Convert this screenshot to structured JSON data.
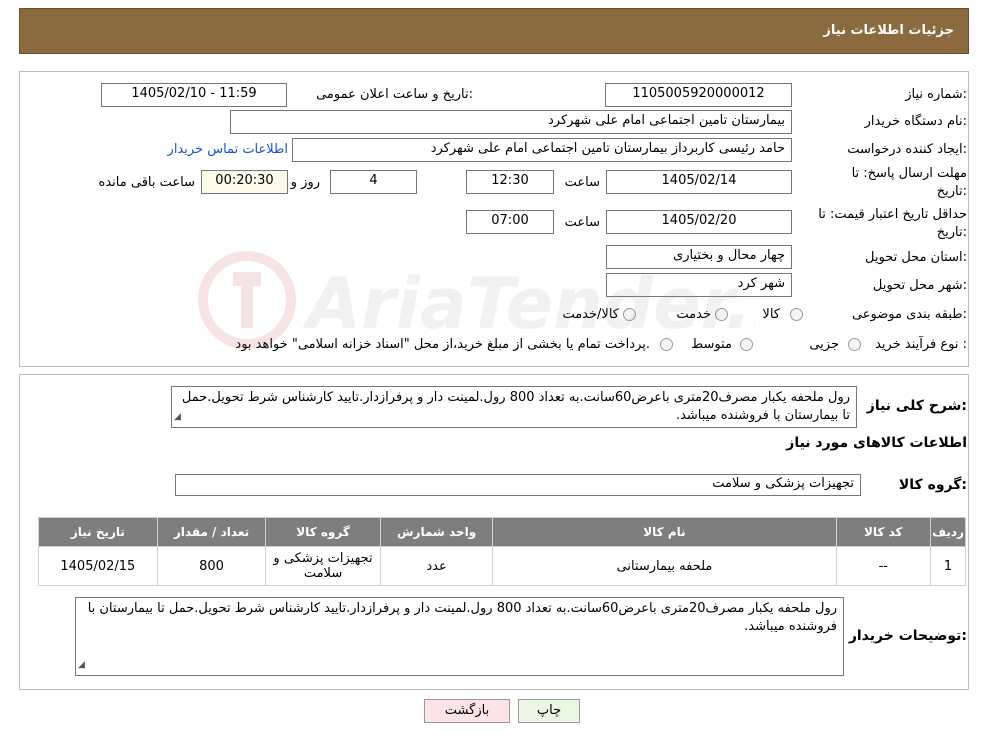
{
  "header": {
    "title": "جزئیات اطلاعات نیاز"
  },
  "form": {
    "need_number_label": "شماره نیاز:",
    "need_number": "1105005920000012",
    "announce_label": "تاریخ و ساعت اعلان عمومی:",
    "announce_value": "1405/02/10 - 11:59",
    "buyer_label": "نام دستگاه خریدار:",
    "buyer_value": "بیمارستان تامین اجتماعی امام علی شهرکرد",
    "creator_label": "ایجاد کننده درخواست:",
    "creator_value": "حامد رئیسی کاربرداز بیمارستان تامین اجتماعی امام علی شهرکرد",
    "contact_link": "اطلاعات تماس خریدار",
    "send_deadline_label_1": "مهلت ارسال پاسخ: تا",
    "send_deadline_label_2": "تاریخ:",
    "send_date": "1405/02/14",
    "time_label": "ساعت",
    "send_time": "12:30",
    "days_value": "4",
    "days_label": "روز و",
    "remaining_value": "00:20:30",
    "remaining_label": "ساعت باقی مانده",
    "price_validity_label_1": "حداقل تاریخ اعتبار قیمت: تا",
    "price_validity_label_2": "تاریخ:",
    "validity_date": "1405/02/20",
    "validity_time": "07:00",
    "province_label": "استان محل تحویل:",
    "province_value": "چهار محال و بختیاری",
    "city_label": "شهر محل تحویل:",
    "city_value": "شهر کرد",
    "category_label": "طبقه بندی موضوعی:",
    "category_options": [
      "کالا",
      "خدمت",
      "کالا/خدمت"
    ],
    "process_label": "نوع فرآیند خرید :",
    "process_options": [
      "جزیی",
      "متوسط"
    ],
    "process_note": "پرداخت تمام یا بخشی از مبلغ خرید،از محل \"اسناد خزانه اسلامی\" خواهد بود."
  },
  "details": {
    "summary_label": "شرح کلی نیاز:",
    "summary_text": "رول ملحفه یکبار مصرف20متری باعرض60سانت.به تعداد 800 رول.لمینت دار و پرفرازدار.تایید کارشناس شرط تحویل.حمل تا بیمارستان با فروشنده میباشد.",
    "goods_info_title": "اطلاعات کالاهای مورد نیاز",
    "goods_group_label": "گروه کالا:",
    "goods_group_value": "تجهیزات پزشکی و سلامت",
    "table": {
      "headers": [
        "ردیف",
        "کد کالا",
        "نام کالا",
        "واحد شمارش",
        "گروه کالا",
        "تعداد / مقدار",
        "تاریخ نیاز"
      ],
      "rows": [
        [
          "1",
          "--",
          "ملحفه بیمارستانی",
          "عدد",
          "تجهیزات پزشکی و سلامت",
          "800",
          "1405/02/15"
        ]
      ]
    },
    "buyer_notes_label": "توضیحات خریدار:",
    "buyer_notes_text": "رول ملحفه یکبار مصرف20متری باعرض60سانت.به تعداد 800 رول.لمینت دار و پرفرازدار.تایید کارشناس شرط تحویل.حمل تا بیمارستان با فروشنده میباشد."
  },
  "buttons": {
    "print": "چاپ",
    "back": "بازگشت"
  },
  "watermark": {
    "text": "AriaTender.neT"
  }
}
